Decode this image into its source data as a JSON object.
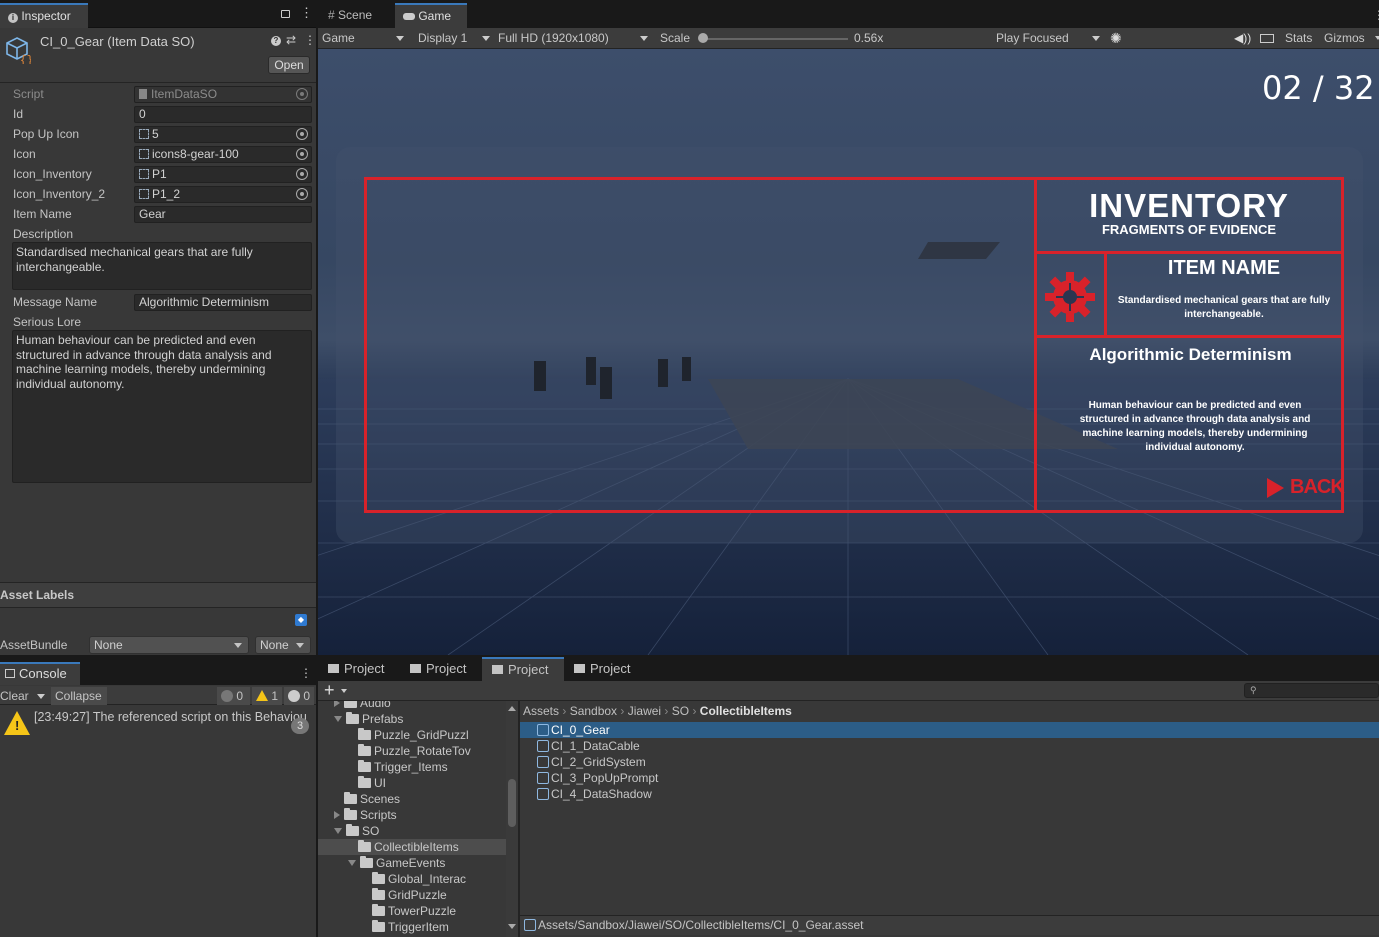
{
  "inspector": {
    "tab_label": "Inspector",
    "title": "CI_0_Gear (Item Data SO)",
    "open_button": "Open",
    "fields": [
      {
        "label": "Script",
        "value": "ItemDataSO"
      },
      {
        "label": "Id",
        "value": "0"
      },
      {
        "label": "Pop Up Icon",
        "value": "5"
      },
      {
        "label": "Icon",
        "value": "icons8-gear-100"
      },
      {
        "label": "Icon_Inventory",
        "value": "P1"
      },
      {
        "label": "Icon_Inventory_2",
        "value": "P1_2"
      },
      {
        "label": "Item Name",
        "value": "Gear"
      }
    ],
    "description_label": "Description",
    "description_value": "Standardised mechanical gears that are fully interchangeable.",
    "message_label": "Message Name",
    "message_value": "Algorithmic Determinism",
    "lore_label": "Serious Lore",
    "lore_value": "Human behaviour can be predicted and even structured in advance through data analysis and machine learning models, thereby undermining individual autonomy.",
    "asset_labels": "Asset Labels",
    "assetbundle_label": "AssetBundle",
    "assetbundle_value": "None",
    "assetbundle_variant": "None"
  },
  "game": {
    "tabs": [
      "Scene",
      "Game"
    ],
    "toolbar": {
      "mode": "Game",
      "display": "Display 1",
      "resolution": "Full HD (1920x1080)",
      "scale_label": "Scale",
      "scale_value": "0.56x",
      "play_mode": "Play Focused",
      "stats": "Stats",
      "gizmos": "Gizmos"
    },
    "counter": "02 / 32",
    "inventory_title": "INVENTORY",
    "inventory_subtitle": "FRAGMENTS OF EVIDENCE",
    "item_name_title": "ITEM NAME",
    "item_desc": "Standardised mechanical gears that are fully interchangeable.",
    "lore_title": "Algorithmic Determinism",
    "lore_text": "Human behaviour can be predicted and even structured in advance through data analysis and machine learning models, thereby undermining individual autonomy.",
    "back_label": "BACK",
    "accent": "#d8222a"
  },
  "console": {
    "tab_label": "Console",
    "clear": "Clear",
    "collapse": "Collapse",
    "info_count": "0",
    "warn_count": "1",
    "error_count": "0",
    "message": "[23:49:27] The referenced script on this Behaviou",
    "badge": "3"
  },
  "project": {
    "tabs": [
      "Project",
      "Project",
      "Project",
      "Project"
    ],
    "tree": [
      {
        "label": "Audio",
        "indent": 1,
        "arrow": "right"
      },
      {
        "label": "Prefabs",
        "indent": 1,
        "arrow": "down"
      },
      {
        "label": "Puzzle_GridPuzzl",
        "indent": 2,
        "arrow": ""
      },
      {
        "label": "Puzzle_RotateTov",
        "indent": 2,
        "arrow": ""
      },
      {
        "label": "Trigger_Items",
        "indent": 2,
        "arrow": ""
      },
      {
        "label": "UI",
        "indent": 2,
        "arrow": ""
      },
      {
        "label": "Scenes",
        "indent": 1,
        "arrow": ""
      },
      {
        "label": "Scripts",
        "indent": 1,
        "arrow": "right"
      },
      {
        "label": "SO",
        "indent": 1,
        "arrow": "down"
      },
      {
        "label": "CollectibleItems",
        "indent": 2,
        "arrow": "",
        "selected": true
      },
      {
        "label": "GameEvents",
        "indent": 2,
        "arrow": "down"
      },
      {
        "label": "Global_Interac",
        "indent": 3,
        "arrow": ""
      },
      {
        "label": "GridPuzzle",
        "indent": 3,
        "arrow": ""
      },
      {
        "label": "TowerPuzzle",
        "indent": 3,
        "arrow": ""
      },
      {
        "label": "TriggerItem",
        "indent": 3,
        "arrow": ""
      }
    ],
    "breadcrumb": [
      "Assets",
      "Sandbox",
      "Jiawei",
      "SO",
      "CollectibleItems"
    ],
    "assets": [
      "CI_0_Gear",
      "CI_1_DataCable",
      "CI_2_GridSystem",
      "CI_3_PopUpPrompt",
      "CI_4_DataShadow"
    ],
    "status_path": "Assets/Sandbox/Jiawei/SO/CollectibleItems/CI_0_Gear.asset"
  }
}
